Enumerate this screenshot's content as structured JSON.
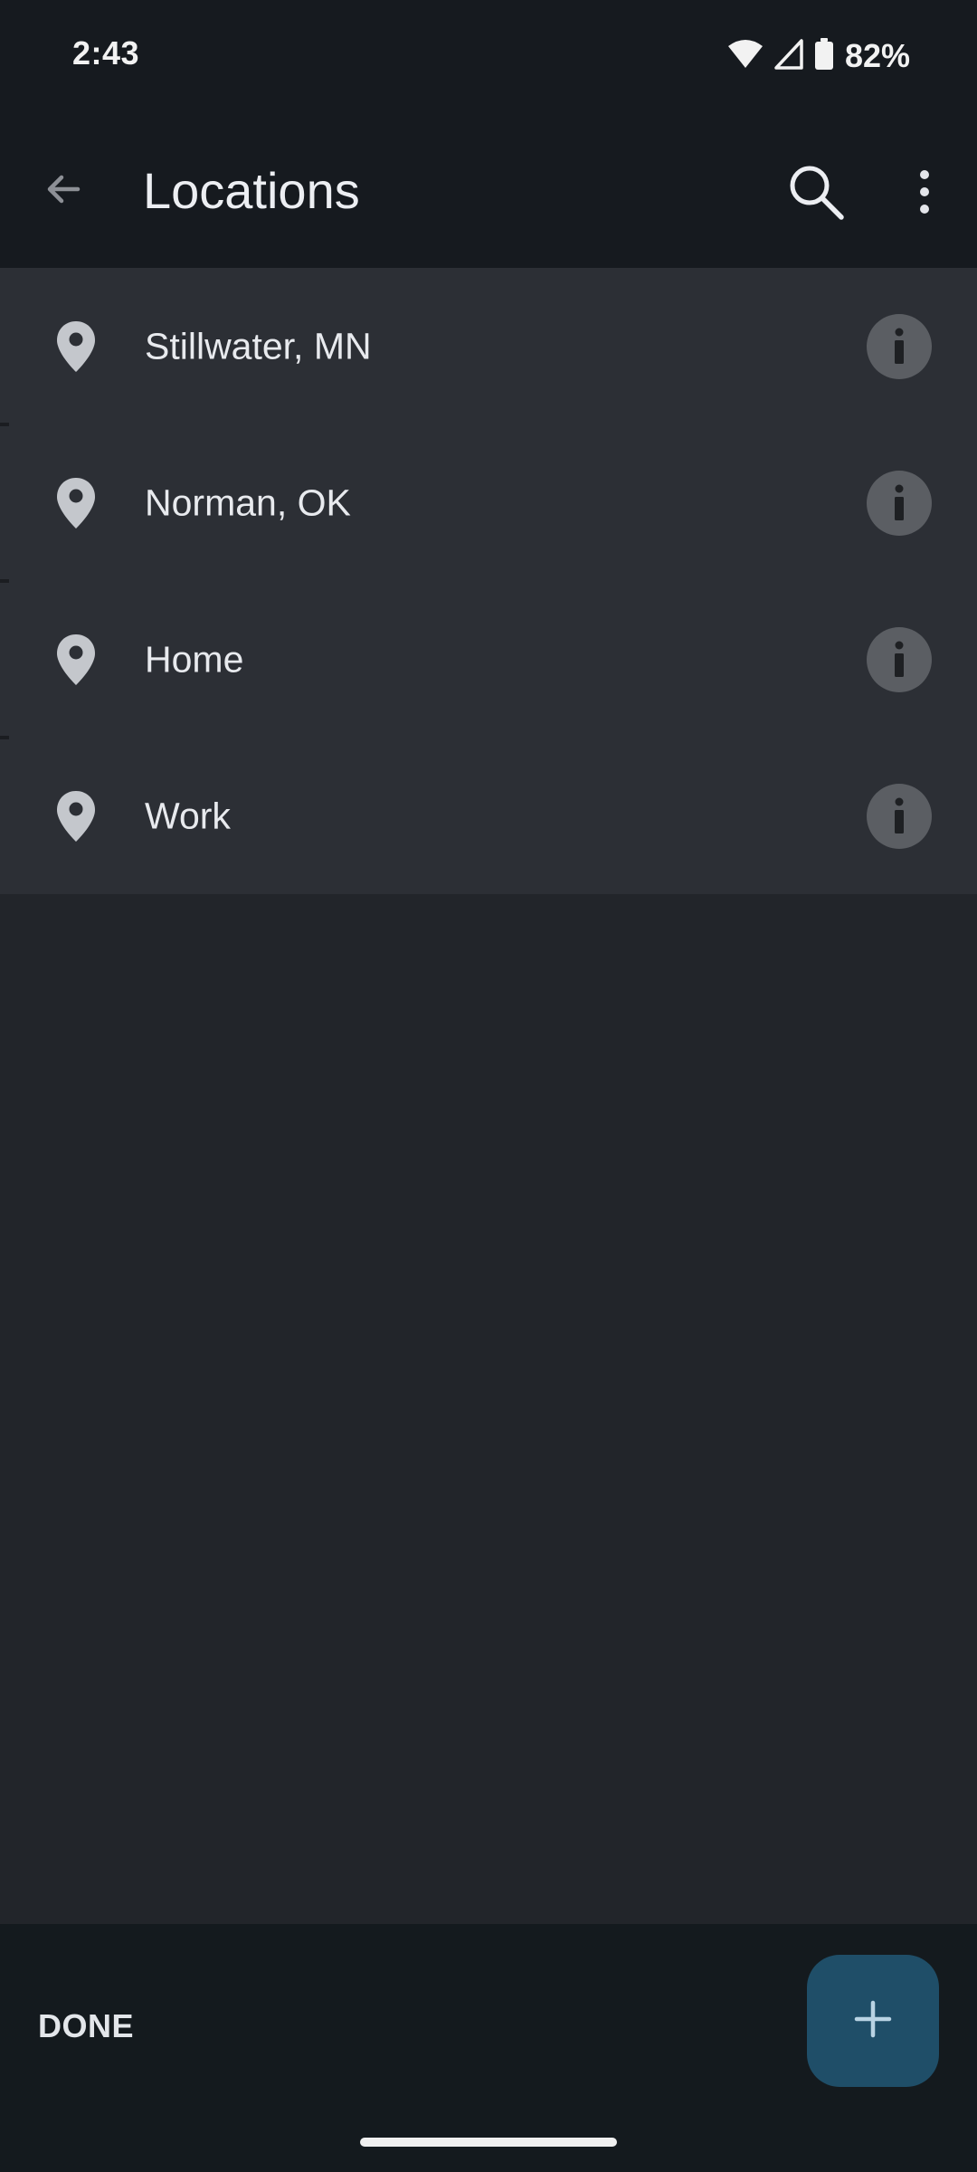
{
  "status_bar": {
    "time": "2:43",
    "battery": "82%",
    "icons": [
      "wifi-icon",
      "cellular-signal-icon",
      "battery-icon"
    ]
  },
  "app_bar": {
    "title": "Locations",
    "icons": [
      "back-arrow-icon",
      "search-icon",
      "more-vert-icon"
    ]
  },
  "locations": [
    {
      "name": "Stillwater, MN",
      "icon": "location-pin-icon",
      "action_icon": "info-icon"
    },
    {
      "name": "Norman, OK",
      "icon": "location-pin-icon",
      "action_icon": "info-icon"
    },
    {
      "name": "Home",
      "icon": "location-pin-icon",
      "action_icon": "info-icon"
    },
    {
      "name": "Work",
      "icon": "location-pin-icon",
      "action_icon": "info-icon"
    }
  ],
  "bottom_bar": {
    "done_label": "DONE",
    "fab_icon": "add-icon"
  },
  "colors": {
    "background": "#22252a",
    "app_bar": "#161a1f",
    "list_background": "#2c2f35",
    "fab": "#1f4e68",
    "info_badge": "#5b5e63"
  }
}
